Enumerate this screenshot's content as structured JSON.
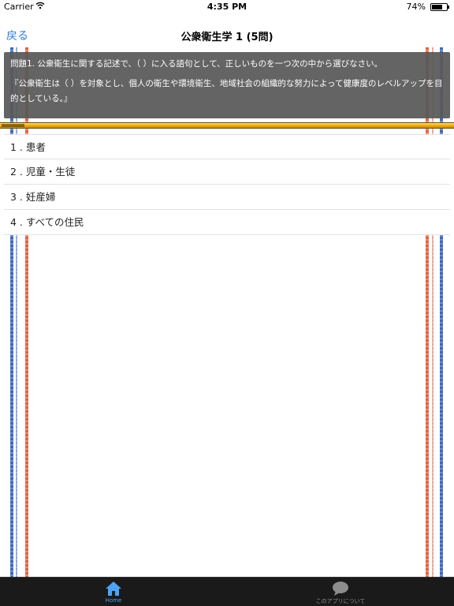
{
  "status_bar": {
    "carrier": "Carrier",
    "time": "4:35 PM",
    "battery_text": "74%",
    "battery_level": 0.74
  },
  "nav": {
    "back_label": "戻る",
    "title": "公衆衛生学 1 (5問)"
  },
  "question": {
    "prompt": "問題1. 公衆衛生に関する記述で、（ ）に入る語句として、正しいものを一つ次の中から選びなさい。",
    "body": "『公衆衛生は（ ）を対象とし、個人の衛生や環境衛生、地域社会の組織的な努力によって健康度のレベルアップを目的としている。』"
  },
  "progress": {
    "fraction": 0.05
  },
  "answers": [
    {
      "label": "1 . 患者"
    },
    {
      "label": "2 . 児童・生徒"
    },
    {
      "label": "3 . 妊産婦"
    },
    {
      "label": "4 . すべての住民"
    }
  ],
  "tabs": [
    {
      "label": "Home",
      "icon": "home-icon",
      "selected": true
    },
    {
      "label": "このアプリについて",
      "icon": "chat-bubble-icon",
      "selected": false
    }
  ],
  "colors": {
    "accent": "#2f7bd9",
    "tab_active": "#4da3f5",
    "tab_inactive": "#8d8d8d",
    "panel": "#585858",
    "gold": "#f7b418"
  }
}
